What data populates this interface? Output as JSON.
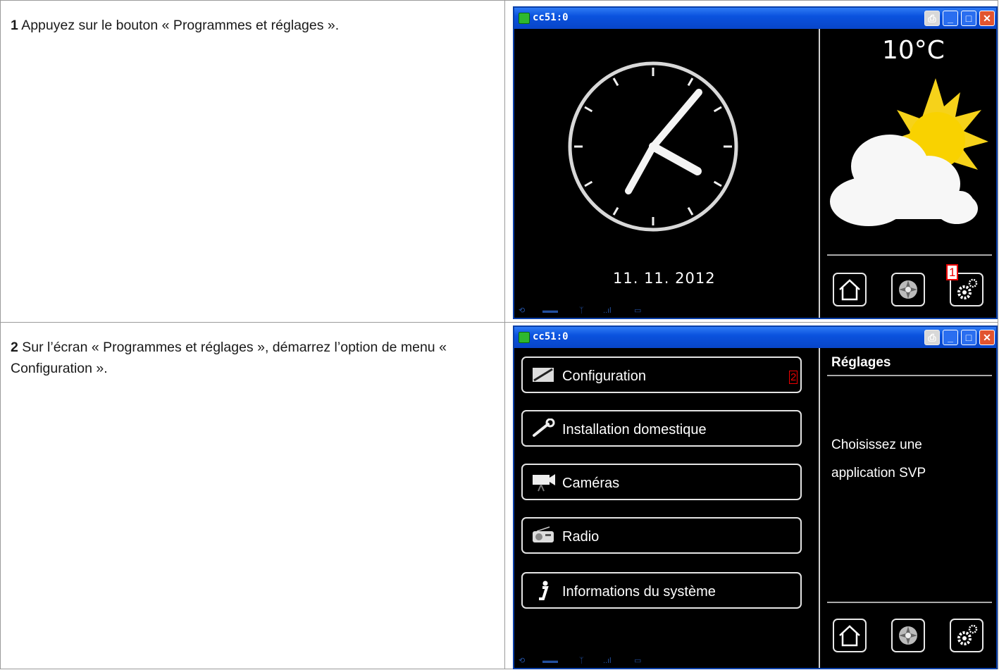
{
  "steps": [
    {
      "number": "1",
      "text": "Appuyez sur le bouton « Programmes et réglages ».",
      "window_title": "cc51:0",
      "temperature": "10°C",
      "date": "11. 11. 2012",
      "marker": "1"
    },
    {
      "number": "2",
      "text": "Sur l’écran « Programmes et réglages », démarrez l’option de menu « Configuration ».",
      "window_title": "cc51:0",
      "marker": "2",
      "menu": [
        {
          "label": "Configuration",
          "icon": "configuration-icon"
        },
        {
          "label": "Installation domestique",
          "icon": "wrench-icon"
        },
        {
          "label": "Caméras",
          "icon": "camera-icon"
        },
        {
          "label": "Radio",
          "icon": "radio-icon"
        },
        {
          "label": "Informations du système",
          "icon": "info-icon"
        }
      ],
      "side_title": "Réglages",
      "side_text": "Choisissez une application SVP"
    }
  ],
  "colors": {
    "titlebar": "#0a52de",
    "marker": "#e00000",
    "screen": "#000000"
  }
}
